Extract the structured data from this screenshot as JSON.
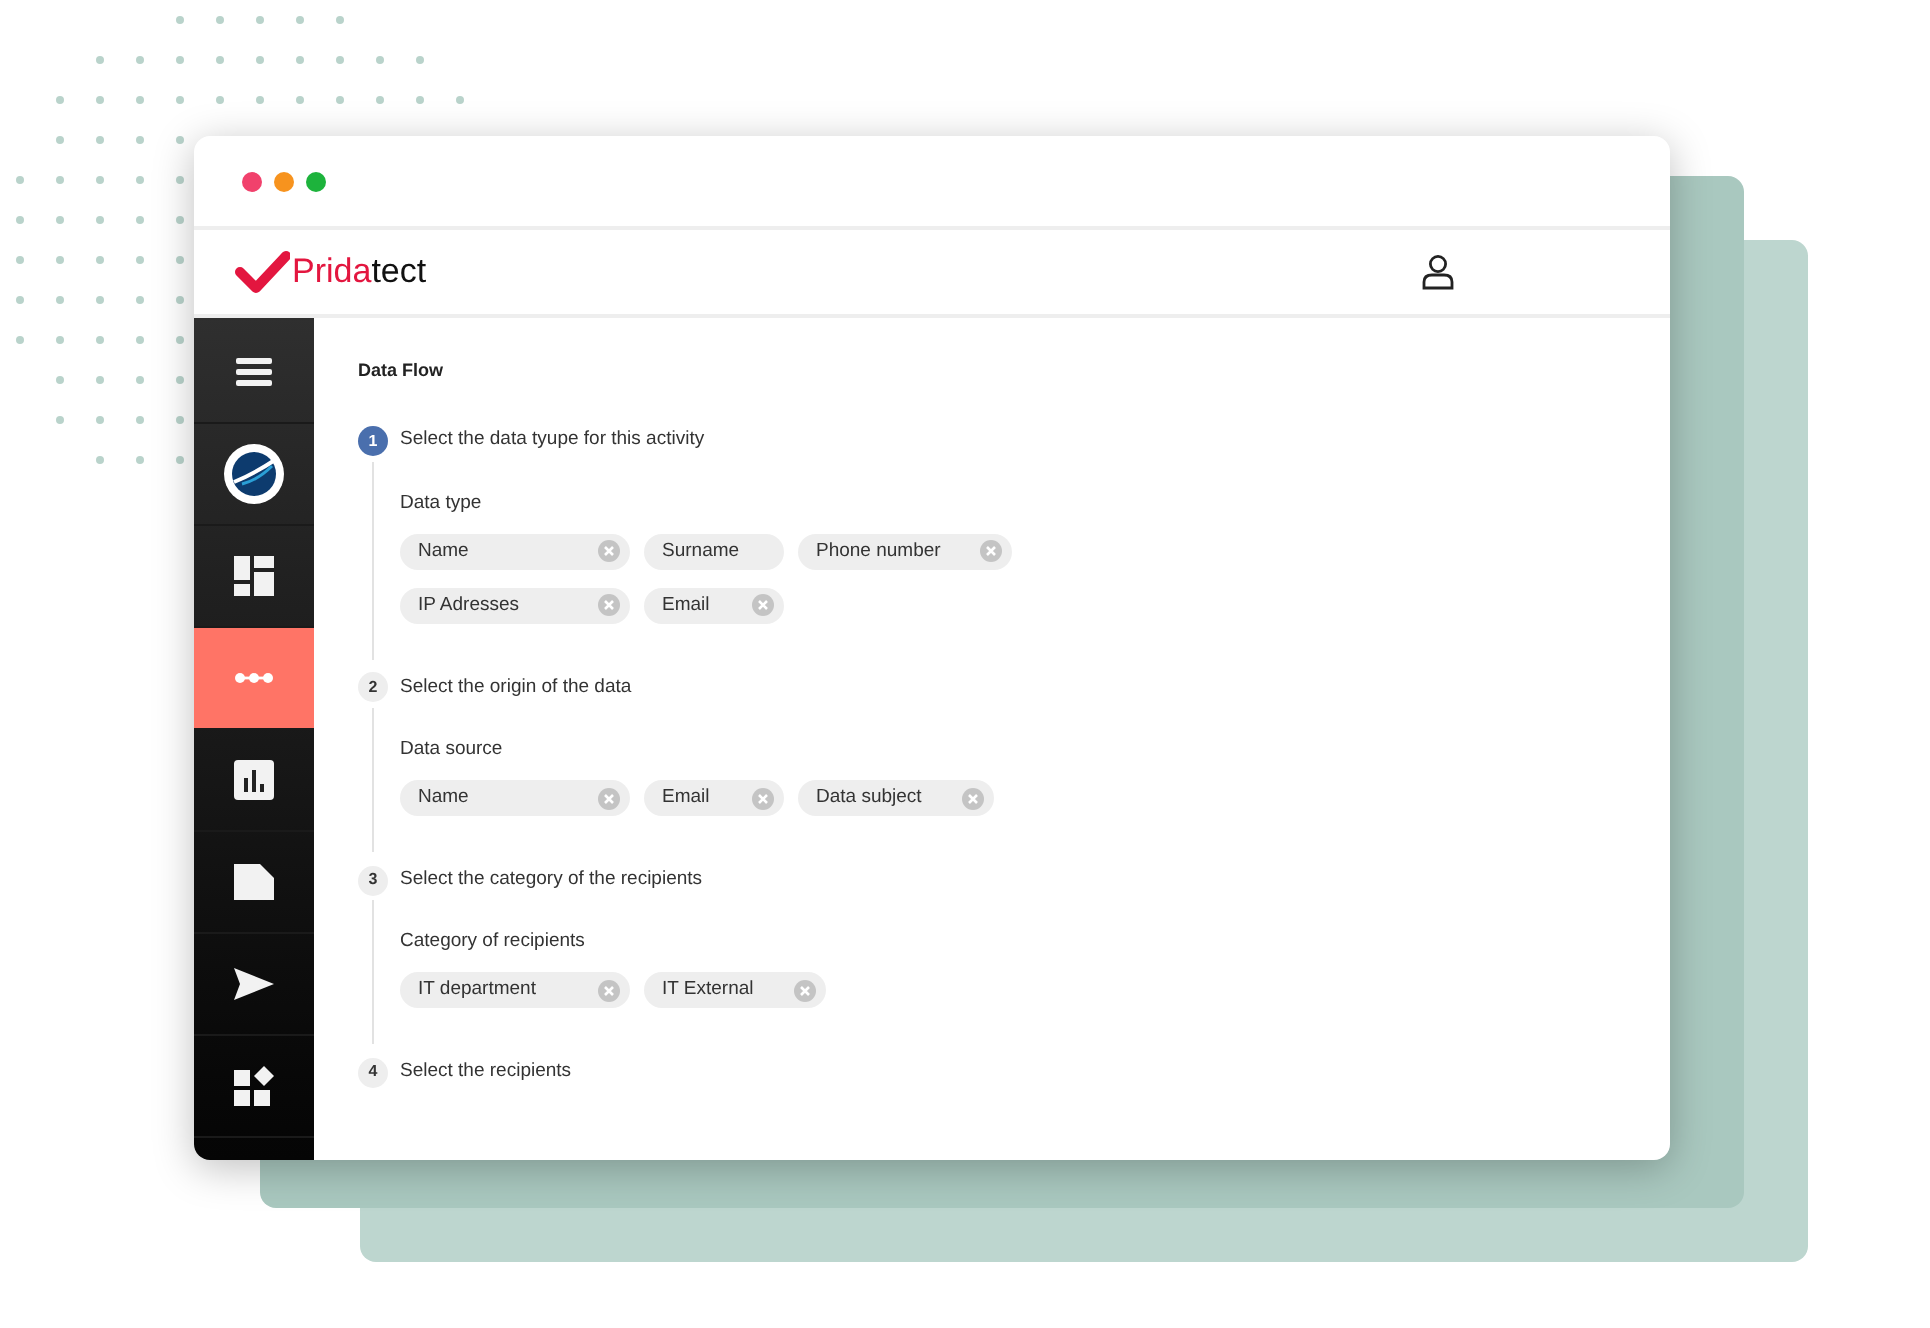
{
  "logo": {
    "accent": "Prida",
    "rest": "tect"
  },
  "sidebar": {
    "items": [
      {
        "kind": "menu",
        "selected": false
      },
      {
        "kind": "globe",
        "selected": false
      },
      {
        "kind": "dashboard",
        "selected": false
      },
      {
        "kind": "flow",
        "selected": true
      },
      {
        "kind": "chart",
        "selected": false
      },
      {
        "kind": "document",
        "selected": false
      },
      {
        "kind": "send",
        "selected": false
      },
      {
        "kind": "widgets",
        "selected": false
      }
    ]
  },
  "page_title": "Data Flow",
  "steps": [
    {
      "number": "1",
      "title": "Select the data tyupe for this activity",
      "selected": true,
      "field_label": "Data type",
      "chips": [
        {
          "label": "Name",
          "removable": true
        },
        {
          "label": "Surname",
          "removable": false
        },
        {
          "label": "Phone number",
          "removable": true
        },
        {
          "label": "IP Adresses",
          "removable": true
        },
        {
          "label": "Email",
          "removable": true
        }
      ]
    },
    {
      "number": "2",
      "title": "Select the origin of the data",
      "selected": false,
      "field_label": "Data source",
      "chips": [
        {
          "label": "Name",
          "removable": true
        },
        {
          "label": "Email",
          "removable": true
        },
        {
          "label": "Data subject",
          "removable": true
        }
      ]
    },
    {
      "number": "3",
      "title": "Select the category of the recipients",
      "selected": false,
      "field_label": "Category of recipients",
      "chips": [
        {
          "label": "IT department",
          "removable": true
        },
        {
          "label": "IT External",
          "removable": true
        }
      ]
    },
    {
      "number": "4",
      "title": "Select the recipients",
      "selected": false
    }
  ]
}
